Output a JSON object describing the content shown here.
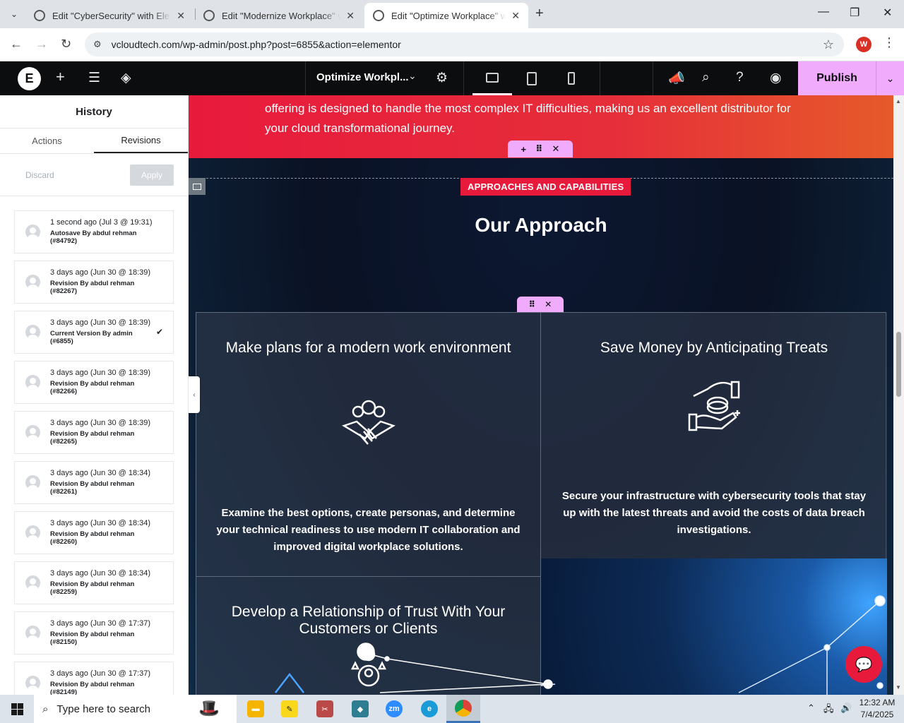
{
  "browser": {
    "tabs": [
      {
        "title": "Edit \"CyberSecurity\" with Elementor",
        "active": false
      },
      {
        "title": "Edit \"Modernize Workplace\" with Elementor",
        "active": false
      },
      {
        "title": "Edit \"Optimize Workplace\" with Elementor",
        "active": true
      }
    ],
    "url": "vcloudtech.com/wp-admin/post.php?post=6855&action=elementor",
    "profile_initial": "W"
  },
  "editor": {
    "document_title": "Optimize Workpl...",
    "publish_label": "Publish"
  },
  "history": {
    "title": "History",
    "tabs": [
      "Actions",
      "Revisions"
    ],
    "active_tab": "Revisions",
    "discard_label": "Discard",
    "apply_label": "Apply",
    "revisions": [
      {
        "when": "1 second ago (Jul 3 @ 19:31)",
        "who": "Autosave By abdul rehman (#84792)",
        "current": false
      },
      {
        "when": "3 days ago (Jun 30 @ 18:39)",
        "who": "Revision By abdul rehman (#82267)",
        "current": false
      },
      {
        "when": "3 days ago (Jun 30 @ 18:39)",
        "who": "Current Version By admin (#6855)",
        "current": true
      },
      {
        "when": "3 days ago (Jun 30 @ 18:39)",
        "who": "Revision By abdul rehman (#82266)",
        "current": false
      },
      {
        "when": "3 days ago (Jun 30 @ 18:39)",
        "who": "Revision By abdul rehman (#82265)",
        "current": false
      },
      {
        "when": "3 days ago (Jun 30 @ 18:34)",
        "who": "Revision By abdul rehman (#82261)",
        "current": false
      },
      {
        "when": "3 days ago (Jun 30 @ 18:34)",
        "who": "Revision By abdul rehman (#82260)",
        "current": false
      },
      {
        "when": "3 days ago (Jun 30 @ 18:34)",
        "who": "Revision By abdul rehman (#82259)",
        "current": false
      },
      {
        "when": "3 days ago (Jun 30 @ 17:37)",
        "who": "Revision By abdul rehman (#82150)",
        "current": false
      },
      {
        "when": "3 days ago (Jun 30 @ 17:37)",
        "who": "Revision By abdul rehman (#82149)",
        "current": false
      }
    ]
  },
  "canvas": {
    "intro_text": "offering is designed to handle the most complex IT difficulties, making us an excellent distributor for your cloud transformational journey.",
    "badge": "APPROACHES AND CAPABILITIES",
    "heading": "Our Approach",
    "cards": [
      {
        "title": "Make plans for a modern work environment",
        "icon": "teamwork-handshake-icon",
        "text": "Examine the best options, create personas, and determine your technical readiness to use modern IT collaboration and improved digital workplace solutions."
      },
      {
        "title": "Save Money by Anticipating Treats",
        "icon": "money-hand-icon",
        "text": "Secure your infrastructure with cybersecurity tools that stay up with the latest threats and avoid the costs of data breach investigations."
      },
      {
        "title": "Develop a Relationship of Trust With Your Customers or Clients",
        "icon": "customer-trust-icon",
        "text": ""
      }
    ]
  },
  "taskbar": {
    "search_placeholder": "Type here to search",
    "time": "12:32 AM",
    "date": "7/4/2025"
  },
  "colors": {
    "elementor_accent": "#f0abfc",
    "brand_red": "#e81a3c",
    "dark_bg": "#0e1a2c"
  }
}
